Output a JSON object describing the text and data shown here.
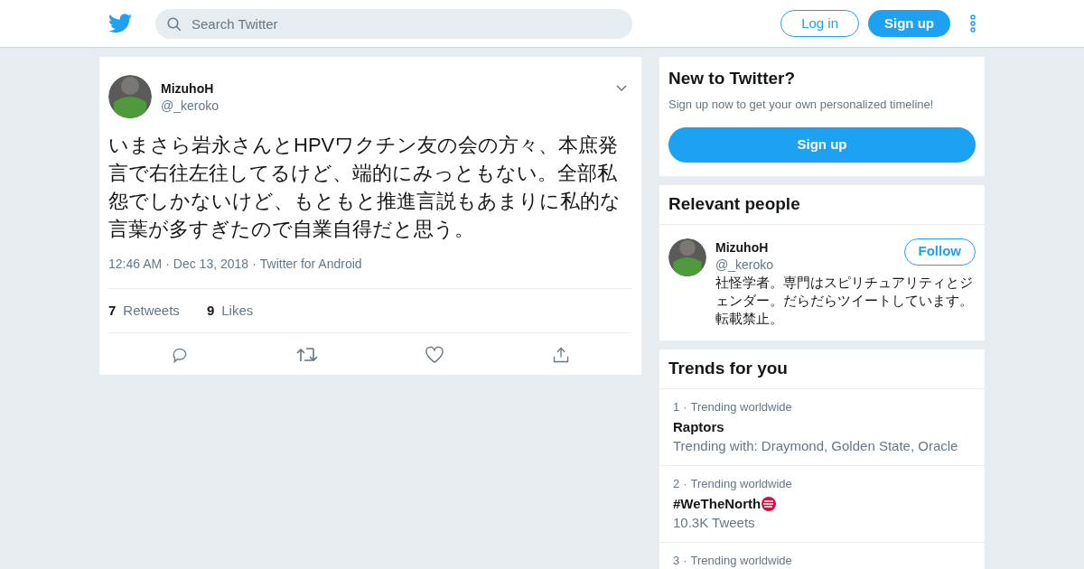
{
  "header": {
    "search": {
      "placeholder": "Search Twitter"
    },
    "login": "Log in",
    "signup": "Sign up"
  },
  "tweet": {
    "name": "MizuhoH",
    "handle": "@_keroko",
    "text": "いまさら岩永さんとHPVワクチン友の会の方々、本庶発言で右往左往してるけど、端的にみっともない。全部私怨でしかないけど、もともと推進言説もあまりに私的な言葉が多すぎたので自業自得だと思う。",
    "time": "12:46 AM",
    "date": "Dec 13, 2018",
    "source": "Twitter for Android",
    "separators": [
      "·",
      "·"
    ],
    "stats": [
      {
        "count": "7",
        "label": "Retweets"
      },
      {
        "count": "9",
        "label": "Likes"
      }
    ]
  },
  "signup_card": {
    "title": "New to Twitter?",
    "subtitle": "Sign up now to get your own personalized timeline!",
    "button": "Sign up"
  },
  "relevant_people": {
    "title": "Relevant people",
    "people": [
      {
        "name": "MizuhoH",
        "handle": "@_keroko",
        "bio": "社怪学者。専門はスピリチュアリティとジェンダー。だらだらツイートしています。転載禁止。",
        "follow": "Follow"
      }
    ]
  },
  "trends": {
    "title": "Trends for you",
    "items": [
      {
        "rank": "1",
        "separator": "·",
        "context": "Trending worldwide",
        "name": "Raptors",
        "meta": "Trending with: Draymond, Golden State, Oracle",
        "has_logo": false
      },
      {
        "rank": "2",
        "separator": "·",
        "context": "Trending worldwide",
        "name": "#WeTheNorth",
        "meta": "10.3K Tweets",
        "has_logo": true
      },
      {
        "rank": "3",
        "separator": "·",
        "context": "Trending worldwide",
        "has_logo": false
      }
    ]
  }
}
